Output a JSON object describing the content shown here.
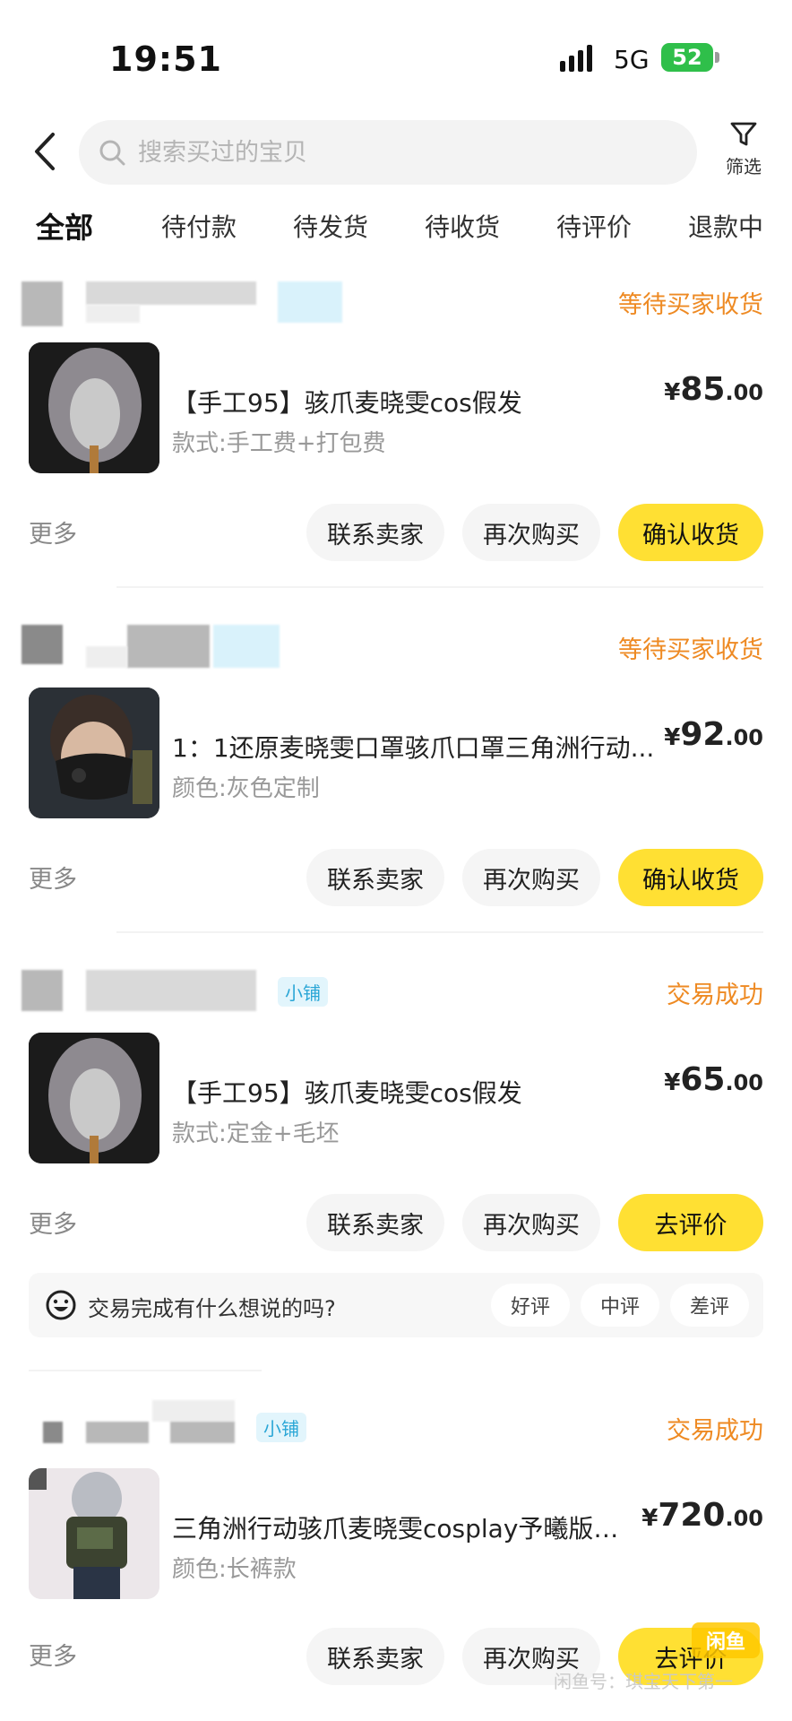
{
  "status_bar": {
    "time": "19:51",
    "network": "5G",
    "battery": "52"
  },
  "search": {
    "placeholder": "搜索买过的宝贝"
  },
  "filter": {
    "label": "筛选"
  },
  "tabs": [
    {
      "label": "全部",
      "active": true
    },
    {
      "label": "待付款"
    },
    {
      "label": "待发货"
    },
    {
      "label": "待收货"
    },
    {
      "label": "待评价"
    },
    {
      "label": "退款中"
    }
  ],
  "orders": [
    {
      "shop_tag": "",
      "status": "等待买家收货",
      "title": "【手工95】骇爪麦晓雯cos假发",
      "spec": "款式:手工费+打包费",
      "price": {
        "currency": "¥",
        "int": "85",
        "dec": ".00"
      },
      "more": "更多",
      "buttons": [
        "联系卖家",
        "再次购买",
        "确认收货"
      ]
    },
    {
      "shop_tag": "",
      "status": "等待买家收货",
      "title": "1：1还原麦晓雯口罩骇爪口罩三角洲行动...",
      "spec": "颜色:灰色定制",
      "price": {
        "currency": "¥",
        "int": "92",
        "dec": ".00"
      },
      "more": "更多",
      "buttons": [
        "联系卖家",
        "再次购买",
        "确认收货"
      ]
    },
    {
      "shop_tag": "小铺",
      "status": "交易成功",
      "title": "【手工95】骇爪麦晓雯cos假发",
      "spec": "款式:定金+毛坯",
      "price": {
        "currency": "¥",
        "int": "65",
        "dec": ".00"
      },
      "more": "更多",
      "buttons": [
        "联系卖家",
        "再次购买",
        "去评价"
      ],
      "review_prompt": {
        "text": "交易完成有什么想说的吗?",
        "chips": [
          "好评",
          "中评",
          "差评"
        ]
      }
    },
    {
      "shop_tag": "小铺",
      "status": "交易成功",
      "title": "三角洲行动骇爪麦晓雯cosplay予曦版二样",
      "spec": "颜色:长裤款",
      "price": {
        "currency": "¥",
        "int": "720",
        "dec": ".00"
      },
      "more": "更多",
      "buttons": [
        "联系卖家",
        "再次购买",
        "去评价"
      ]
    }
  ],
  "watermark": {
    "logo": "闲鱼",
    "text": "闲鱼号：琪宝天下第一"
  },
  "colors": {
    "accent_yellow": "#ffe033",
    "status_orange": "#ee8a23",
    "shop_tag_blue": "#2aa6d6"
  }
}
